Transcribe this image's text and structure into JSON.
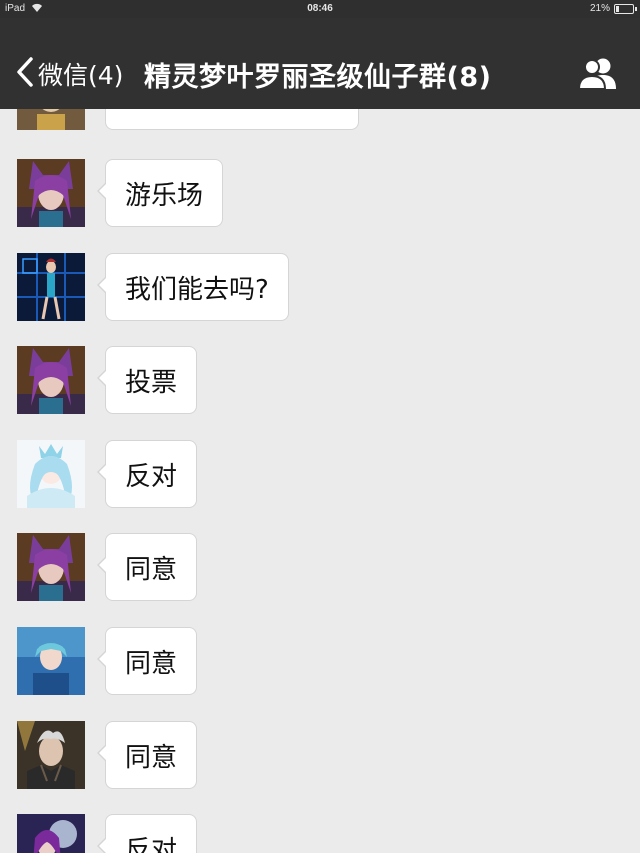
{
  "status_bar": {
    "carrier": "iPad",
    "time": "08:46",
    "battery_percent_text": "21%",
    "battery_level": 0.21
  },
  "nav": {
    "back_label": "微信(4)",
    "title": "精灵梦叶罗丽圣级仙子群(8)",
    "icons": {
      "back": "chevron-left-icon",
      "members": "group-members-icon"
    }
  },
  "messages": [
    {
      "text": "",
      "avatar": "avatar-blonde-warrior"
    },
    {
      "text": "游乐场",
      "avatar": "avatar-purple-cat-ear"
    },
    {
      "text": "我们能去吗?",
      "avatar": "avatar-blue-dancer"
    },
    {
      "text": "投票",
      "avatar": "avatar-purple-cat-ear"
    },
    {
      "text": "反对",
      "avatar": "avatar-ice-fairy"
    },
    {
      "text": "同意",
      "avatar": "avatar-purple-cat-ear"
    },
    {
      "text": "同意",
      "avatar": "avatar-teal-fairy"
    },
    {
      "text": "同意",
      "avatar": "avatar-dark-armored"
    },
    {
      "text": "反对",
      "avatar": "avatar-purple-moon"
    }
  ],
  "colors": {
    "nav_bg": "#313131",
    "status_bg": "#2f2f2f",
    "chat_bg": "#ebebeb",
    "bubble_bg": "#ffffff",
    "bubble_border": "#d5d5d5"
  }
}
